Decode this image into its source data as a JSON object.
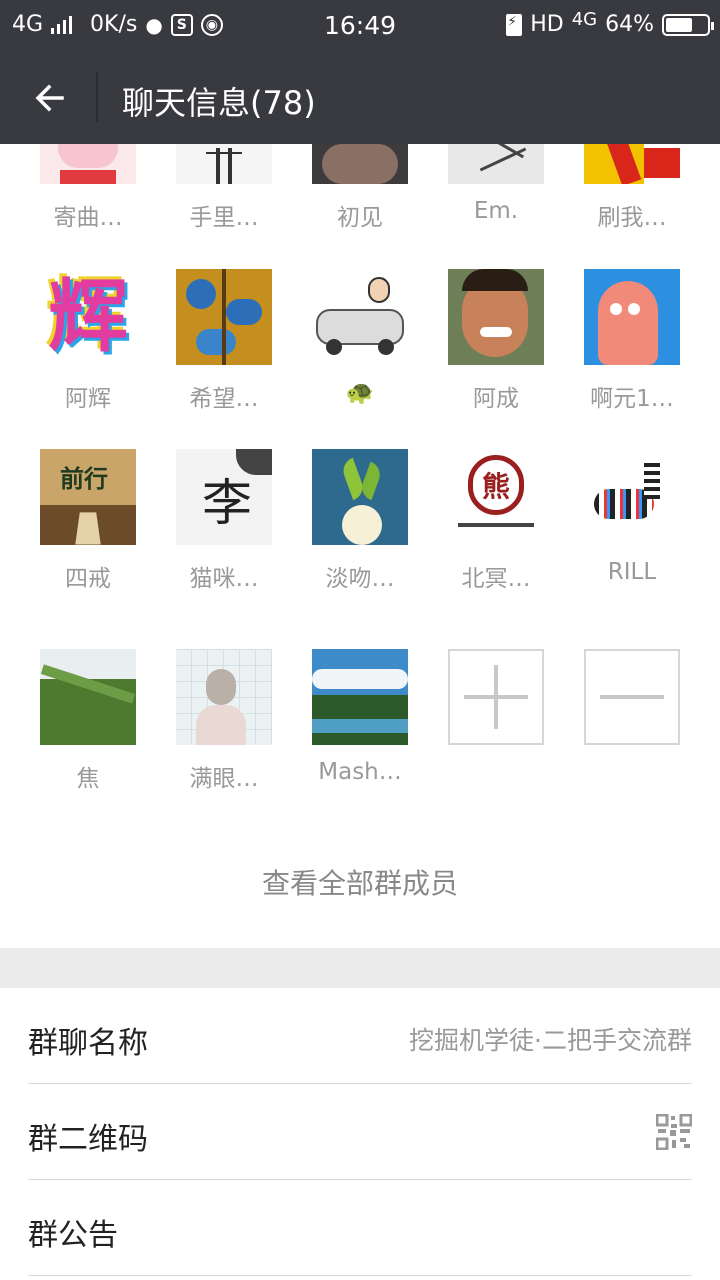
{
  "status_bar": {
    "network": "4G",
    "speed": "0K/s",
    "time": "16:49",
    "hd": "HD",
    "network_right": "4G",
    "battery": "64%",
    "battery_level": 0.64
  },
  "header": {
    "title": "聊天信息(78)"
  },
  "members": [
    {
      "name": "寄曲…",
      "avatar": "pig-avatar"
    },
    {
      "name": "手里…",
      "avatar": "sketch-avatar"
    },
    {
      "name": "初见",
      "avatar": "dark-avatar"
    },
    {
      "name": "Em.",
      "avatar": "drawing-avatar"
    },
    {
      "name": "刷我…",
      "avatar": "flag-avatar"
    },
    {
      "name": "阿辉",
      "avatar": "rainbow-text-avatar"
    },
    {
      "name": "希望…",
      "avatar": "tree-avatar"
    },
    {
      "name": "🐢",
      "avatar": "car-avatar"
    },
    {
      "name": "阿成",
      "avatar": "child-avatar"
    },
    {
      "name": "啊元1…",
      "avatar": "starfish-avatar"
    },
    {
      "name": "四戒",
      "avatar": "road-avatar"
    },
    {
      "name": "猫咪…",
      "avatar": "calligraphy-avatar"
    },
    {
      "name": "淡吻…",
      "avatar": "sprout-avatar"
    },
    {
      "name": "北冥…",
      "avatar": "emblem-avatar"
    },
    {
      "name": "RILL",
      "avatar": "zebra-avatar"
    },
    {
      "name": "焦",
      "avatar": "field-avatar"
    },
    {
      "name": "满眼…",
      "avatar": "person-avatar"
    },
    {
      "name": "Mash…",
      "avatar": "landscape-avatar"
    }
  ],
  "view_all": "查看全部群成员",
  "settings": {
    "group_name_label": "群聊名称",
    "group_name_value": "挖掘机学徒·二把手交流群",
    "qr_label": "群二维码",
    "notice_label": "群公告"
  }
}
